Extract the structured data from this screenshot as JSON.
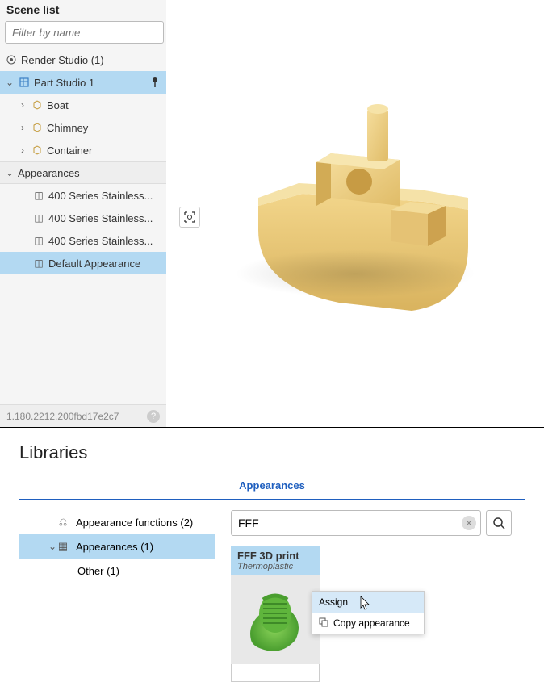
{
  "sidebar": {
    "title": "Scene list",
    "filter_placeholder": "Filter by name",
    "items": [
      {
        "label": "Render Studio (1)",
        "icon": "render-icon",
        "expandable": false
      },
      {
        "label": "Part Studio 1",
        "icon": "part-icon",
        "expandable": true,
        "expanded": true,
        "selected": true,
        "trailing": "pin-icon"
      },
      {
        "label": "Boat",
        "icon": "solid-icon",
        "depth": 2
      },
      {
        "label": "Chimney",
        "icon": "solid-icon",
        "depth": 2
      },
      {
        "label": "Container",
        "icon": "solid-icon",
        "depth": 2
      }
    ],
    "appearances_header": "Appearances",
    "appearances": [
      {
        "label": "400 Series Stainless..."
      },
      {
        "label": "400 Series Stainless..."
      },
      {
        "label": "400 Series Stainless..."
      },
      {
        "label": "Default Appearance",
        "selected": true
      }
    ],
    "version": "1.180.2212.200fbd17e2c7"
  },
  "libraries": {
    "title": "Libraries",
    "tab": "Appearances",
    "tree": [
      {
        "label": "Appearance functions (2)",
        "icon": "function-icon"
      },
      {
        "label": "Appearances (1)",
        "icon": "swatch-icon",
        "selected": true,
        "expanded": true
      },
      {
        "label": "Other (1)",
        "depth": 2
      }
    ],
    "search_value": "FFF",
    "card": {
      "title": "FFF 3D print",
      "subtitle": "Thermoplastic"
    },
    "menu": {
      "assign": "Assign",
      "copy": "Copy appearance"
    }
  }
}
